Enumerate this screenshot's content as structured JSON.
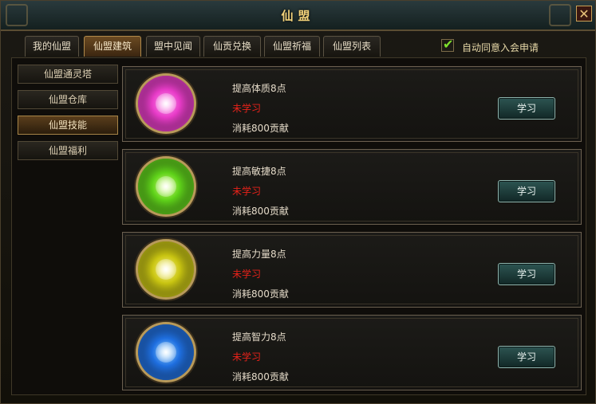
{
  "window": {
    "title": "仙盟",
    "close_glyph": "✕"
  },
  "tabs": [
    {
      "label": "我的仙盟"
    },
    {
      "label": "仙盟建筑"
    },
    {
      "label": "盟中见闻"
    },
    {
      "label": "仙贡兑换"
    },
    {
      "label": "仙盟祈福"
    },
    {
      "label": "仙盟列表"
    }
  ],
  "active_tab": "仙盟建筑",
  "auto_accept": {
    "label": "自动同意入会申请",
    "checked": true,
    "check_glyph": "✔"
  },
  "sidebar": {
    "items": [
      {
        "label": "仙盟通灵塔"
      },
      {
        "label": "仙盟仓库"
      },
      {
        "label": "仙盟技能"
      },
      {
        "label": "仙盟福利"
      }
    ],
    "active": "仙盟技能"
  },
  "skills": [
    {
      "name": "提高体质8点",
      "status": "未学习",
      "cost": "消耗800贡献",
      "button": "学习",
      "orb_color": "#e83cc8",
      "orb_glow": "#ff9af0"
    },
    {
      "name": "提高敏捷8点",
      "status": "未学习",
      "cost": "消耗800贡献",
      "button": "学习",
      "orb_color": "#5fd21a",
      "orb_glow": "#d9ff7a"
    },
    {
      "name": "提高力量8点",
      "status": "未学习",
      "cost": "消耗800贡献",
      "button": "学习",
      "orb_color": "#c9c512",
      "orb_glow": "#fff58a"
    },
    {
      "name": "提高智力8点",
      "status": "未学习",
      "cost": "消耗800贡献",
      "button": "学习",
      "orb_color": "#1f6fe0",
      "orb_glow": "#8fd4ff"
    }
  ],
  "colors": {
    "status_unlearned": "#e8221a",
    "title_gold": "#f2d27a",
    "check_green": "#7fe12c"
  }
}
